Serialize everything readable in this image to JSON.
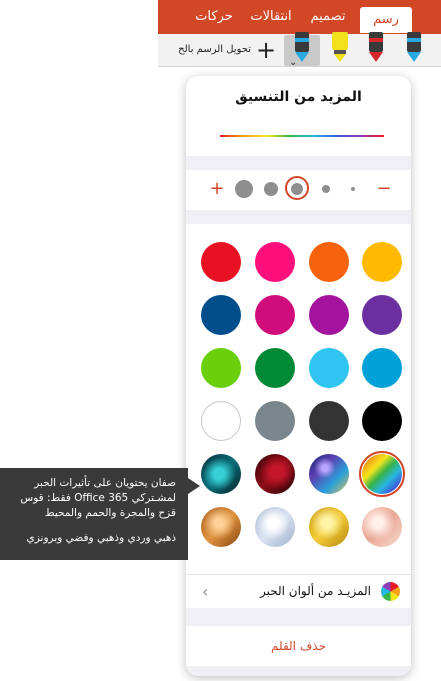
{
  "ribbon": {
    "tabs": [
      {
        "label": "رسم",
        "selected": true
      },
      {
        "label": "تصميم",
        "selected": false
      },
      {
        "label": "انتقالات",
        "selected": false
      },
      {
        "label": "حركات",
        "selected": false
      }
    ],
    "accent_color": "#d24726"
  },
  "toolbar": {
    "convert_label": "تحويل الرسم بالح",
    "add_label": "+",
    "pens": [
      {
        "icon": "pen-icon",
        "color": "#29a9e0"
      },
      {
        "icon": "pen-icon",
        "color": "#d62828"
      },
      {
        "icon": "highlighter-icon",
        "color": "#f2e21b"
      },
      {
        "icon": "pen-icon",
        "color": "#29a9e0",
        "selected": true
      }
    ]
  },
  "popover": {
    "title": "المزيد من التنسيق",
    "size": {
      "decrease": "−",
      "increase": "+",
      "selected_index": 2
    },
    "swatches": [
      [
        "#ffb900",
        "#f7630c",
        "#ff0f7b",
        "#e81123"
      ],
      [
        "#6b2fa0",
        "#a4139d",
        "#d00d7a",
        "#004e8c"
      ],
      [
        "#00a0d9",
        "#2fc5f0",
        "#008a36",
        "#6ccf0e"
      ],
      [
        "#000000",
        "#333333",
        "#7a868c",
        "#ffffff"
      ],
      [
        "rainbow",
        "galaxy",
        "lava",
        "ocean"
      ],
      [
        "rose-gold",
        "gold",
        "silver",
        "bronze"
      ]
    ],
    "selected_swatch": "rainbow",
    "more_colors_label": "المزيـد من ألوان الحبر",
    "delete_label": "حذف القلم"
  },
  "callout": {
    "line1": "صفان يحتويان على تأثيرات الحبر",
    "line2": "لمشـتركي Office 365 فقط: قوس",
    "line3": "قزح والمجرة والحمم والمحيط",
    "line4": "ذهبي وردي وذهبي وفضي وبرونزي"
  }
}
